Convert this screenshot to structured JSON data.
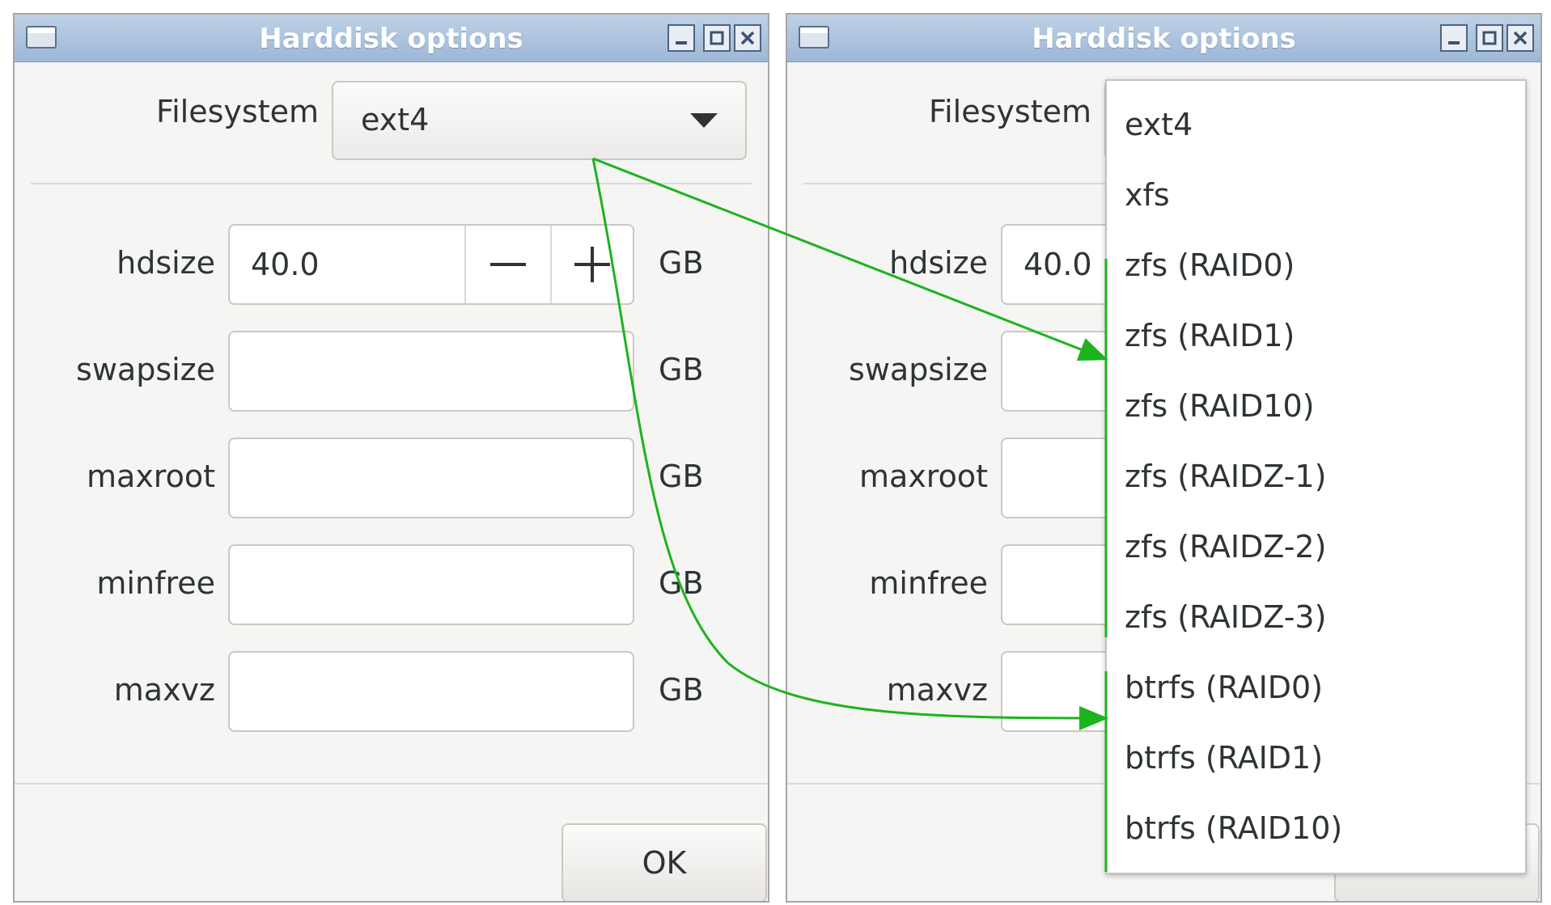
{
  "window": {
    "title": "Harddisk options",
    "icons": [
      "app-icon",
      "minimize-icon",
      "maximize-icon",
      "close-icon"
    ]
  },
  "form": {
    "filesystem_label": "Filesystem",
    "filesystem_value": "ext4",
    "fields": [
      {
        "label": "hdsize",
        "value": "40.0",
        "unit": "GB"
      },
      {
        "label": "swapsize",
        "value": "",
        "unit": "GB"
      },
      {
        "label": "maxroot",
        "value": "",
        "unit": "GB"
      },
      {
        "label": "minfree",
        "value": "",
        "unit": "GB"
      },
      {
        "label": "maxvz",
        "value": "",
        "unit": "GB"
      }
    ],
    "ok_label": "OK"
  },
  "dropdown": {
    "options": [
      "ext4",
      "xfs",
      "zfs (RAID0)",
      "zfs (RAID1)",
      "zfs (RAID10)",
      "zfs (RAIDZ-1)",
      "zfs (RAIDZ-2)",
      "zfs (RAIDZ-3)",
      "btrfs (RAID0)",
      "btrfs (RAID1)",
      "btrfs (RAID10)"
    ]
  },
  "annotation": {
    "color": "#1db31d"
  }
}
